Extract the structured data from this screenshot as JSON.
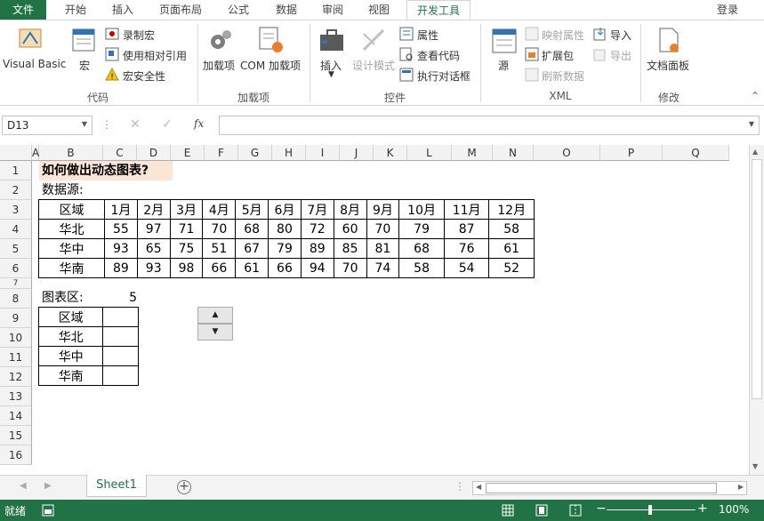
{
  "tabs": [
    "文件",
    "开始",
    "插入",
    "页面布局",
    "公式",
    "数据",
    "审阅",
    "视图",
    "开发工具"
  ],
  "login": "登录",
  "ribbon": {
    "code": {
      "vb": "Visual Basic",
      "macro": "宏",
      "record": "录制宏",
      "relative": "使用相对引用",
      "security": "宏安全性",
      "group": "代码"
    },
    "addins": {
      "addins": "加载项",
      "com": "COM 加载项",
      "group": "加载项"
    },
    "controls": {
      "insert": "插入",
      "design": "设计模式",
      "props": "属性",
      "viewcode": "查看代码",
      "dialog": "执行对话框",
      "group": "控件"
    },
    "xml": {
      "source": "源",
      "mapprops": "映射属性",
      "expand": "扩展包",
      "refresh": "刷新数据",
      "import": "导入",
      "export": "导出",
      "group": "XML"
    },
    "modify": {
      "docpanel": "文档面板",
      "group": "修改"
    }
  },
  "namebox": "D13",
  "fx": "fx",
  "columns": [
    "A",
    "B",
    "C",
    "D",
    "E",
    "F",
    "G",
    "H",
    "I",
    "J",
    "K",
    "L",
    "M",
    "N",
    "O",
    "P",
    "Q"
  ],
  "rows": [
    "1",
    "2",
    "3",
    "4",
    "5",
    "6",
    "7",
    "8",
    "9",
    "10",
    "11",
    "12",
    "13",
    "14",
    "15",
    "16"
  ],
  "sheet": {
    "title": "如何做出动态图表?",
    "source_label": "数据源:",
    "header": [
      "区域",
      "1月",
      "2月",
      "3月",
      "4月",
      "5月",
      "6月",
      "7月",
      "8月",
      "9月",
      "10月",
      "11月",
      "12月"
    ],
    "data": [
      [
        "华北",
        "55",
        "97",
        "71",
        "70",
        "68",
        "80",
        "72",
        "60",
        "70",
        "79",
        "87",
        "58"
      ],
      [
        "华中",
        "93",
        "65",
        "75",
        "51",
        "67",
        "79",
        "89",
        "85",
        "81",
        "68",
        "76",
        "61"
      ],
      [
        "华南",
        "89",
        "93",
        "98",
        "66",
        "61",
        "66",
        "94",
        "70",
        "74",
        "58",
        "54",
        "52"
      ]
    ],
    "chart_label": "图表区:",
    "chart_value": "5",
    "chart_rows": [
      "区域",
      "华北",
      "华中",
      "华南"
    ]
  },
  "sheet_tab": "Sheet1",
  "status": {
    "ready": "就绪",
    "zoom": "100%"
  }
}
